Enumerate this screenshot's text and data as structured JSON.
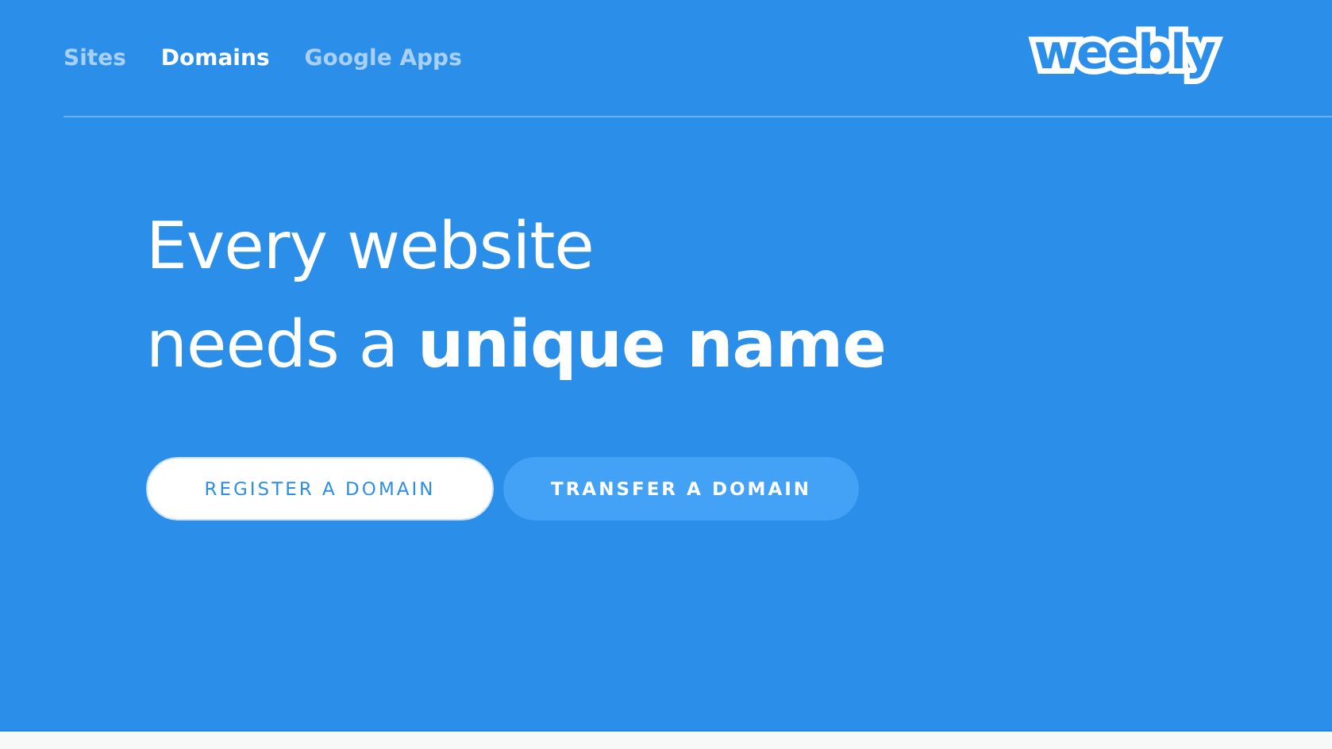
{
  "nav": {
    "items": [
      {
        "label": "Sites",
        "selected": false
      },
      {
        "label": "Domains",
        "selected": true
      },
      {
        "label": "Google Apps",
        "selected": false
      }
    ],
    "logo": "weebly"
  },
  "hero": {
    "headline": [
      "Every website",
      "needs a **unique name**"
    ],
    "buttons": [
      {
        "label": "REGISTER A DOMAIN",
        "kind": "primary"
      },
      {
        "label": "TRANSFER A DOMAIN",
        "kind": "secondary"
      }
    ]
  }
}
